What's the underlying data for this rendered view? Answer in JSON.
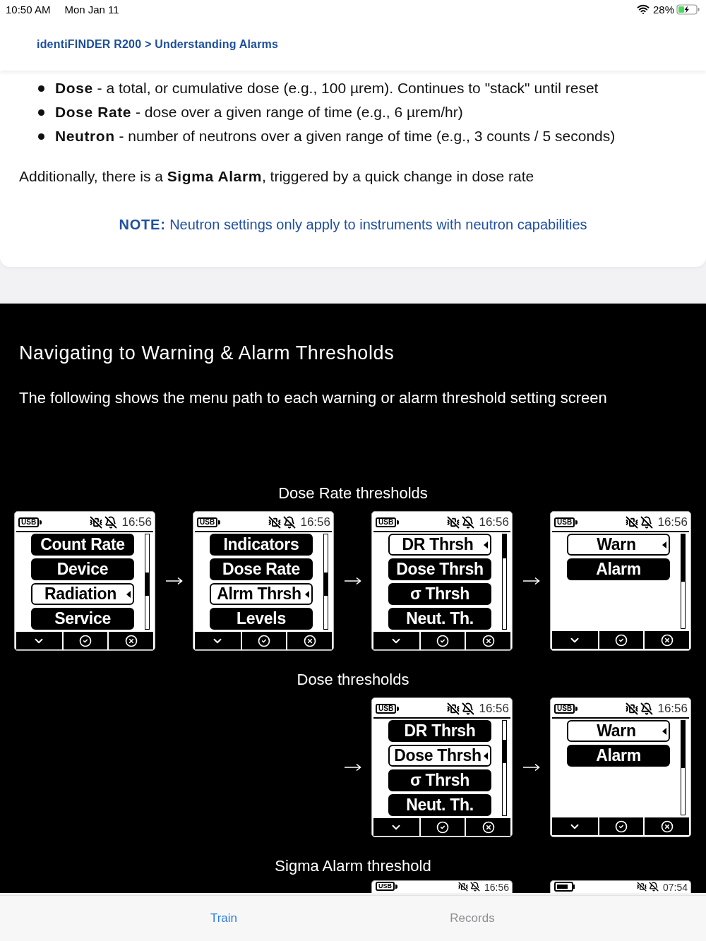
{
  "status_bar": {
    "time": "10:50 AM",
    "date": "Mon Jan 11",
    "battery": "28%"
  },
  "header": {
    "breadcrumb": "identiFINDER R200 > Understanding Alarms"
  },
  "article": {
    "alarm_types": [
      "**Dose** - a total, or cumulative dose (e.g., 100 µrem). Continues to \"stack\" until reset",
      "**Dose Rate** - dose over a given range of time (e.g., 6 µrem/hr)",
      "**Neutron** - number of neutrons over a given range of time (e.g., 3 counts / 5 seconds)"
    ],
    "paragraph": "Additionally, there is a **Sigma Alarm**, triggered by a quick change in dose rate",
    "note": "**NOTE:** Neutron settings only apply to instruments with neutron capabilities"
  },
  "section": {
    "title": "Navigating to Warning & Alarm Thresholds",
    "intro": "The following shows the menu path to each warning or alarm threshold setting screen",
    "groups": [
      {
        "caption": "Dose Rate thresholds",
        "screens": [
          {
            "arrow_before": false,
            "power_label": "USB",
            "time": "16:56",
            "items": [
              {
                "label": "Count Rate",
                "selected": false
              },
              {
                "label": "Device",
                "selected": false
              },
              {
                "label": "Radiation",
                "selected": true
              },
              {
                "label": "Service",
                "selected": false
              }
            ]
          },
          {
            "arrow_before": true,
            "power_label": "USB",
            "time": "16:56",
            "items": [
              {
                "label": "Indicators",
                "selected": false
              },
              {
                "label": "Dose Rate",
                "selected": false
              },
              {
                "label": "Alrm Thrsh",
                "selected": true
              },
              {
                "label": "Levels",
                "selected": false
              }
            ]
          },
          {
            "arrow_before": true,
            "power_label": "USB",
            "time": "16:56",
            "items": [
              {
                "label": "DR Thrsh",
                "selected": true
              },
              {
                "label": "Dose Thrsh",
                "selected": false
              },
              {
                "label": "σ Thrsh",
                "selected": false
              },
              {
                "label": "Neut. Th.",
                "selected": false
              }
            ]
          },
          {
            "arrow_before": true,
            "power_label": "USB",
            "time": "16:56",
            "items": [
              {
                "label": "Warn",
                "selected": true
              },
              {
                "label": "Alarm",
                "selected": false
              }
            ]
          }
        ]
      },
      {
        "caption": "Dose thresholds",
        "screens": [
          {
            "arrow_before": true,
            "power_label": "USB",
            "time": "16:56",
            "items": [
              {
                "label": "DR Thrsh",
                "selected": false
              },
              {
                "label": "Dose Thrsh",
                "selected": true
              },
              {
                "label": "σ Thrsh",
                "selected": false
              },
              {
                "label": "Neut. Th.",
                "selected": false
              }
            ]
          },
          {
            "arrow_before": true,
            "power_label": "USB",
            "time": "16:56",
            "items": [
              {
                "label": "Warn",
                "selected": true
              },
              {
                "label": "Alarm",
                "selected": false
              }
            ]
          }
        ]
      },
      {
        "caption": "Sigma Alarm threshold",
        "screens": [
          {
            "arrow_before": false,
            "power_label": "USB",
            "time": "16:56"
          },
          {
            "arrow_before": false,
            "time": "07:54"
          }
        ]
      }
    ]
  },
  "tab_bar": [
    {
      "label": "Train",
      "selected": true
    },
    {
      "label": "Records",
      "selected": false
    }
  ]
}
